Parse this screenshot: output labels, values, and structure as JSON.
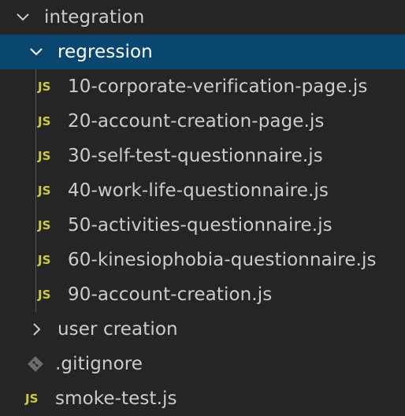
{
  "explorer": {
    "root_folder": {
      "label": "integration",
      "icon": "chevron-down-icon"
    },
    "regression_folder": {
      "label": "regression",
      "icon": "chevron-down-icon",
      "selected": true
    },
    "regression_files": [
      {
        "label": "10-corporate-verification-page.js",
        "icon": "JS"
      },
      {
        "label": "20-account-creation-page.js",
        "icon": "JS"
      },
      {
        "label": "30-self-test-questionnaire.js",
        "icon": "JS"
      },
      {
        "label": "40-work-life-questionnaire.js",
        "icon": "JS"
      },
      {
        "label": "50-activities-questionnaire.js",
        "icon": "JS"
      },
      {
        "label": "60-kinesiophobia-questionnaire.js",
        "icon": "JS"
      },
      {
        "label": "90-account-creation.js",
        "icon": "JS"
      }
    ],
    "user_creation_folder": {
      "label": "user creation",
      "icon": "chevron-right-icon"
    },
    "gitignore_file": {
      "label": ".gitignore",
      "icon": "git-icon"
    },
    "smoke_test_file": {
      "label": "smoke-test.js",
      "icon": "JS"
    }
  },
  "colors": {
    "background": "#252526",
    "selected_background": "#094771",
    "text": "#cccccc",
    "js_icon": "#cbcb41",
    "git_icon": "#6d6d6d"
  }
}
